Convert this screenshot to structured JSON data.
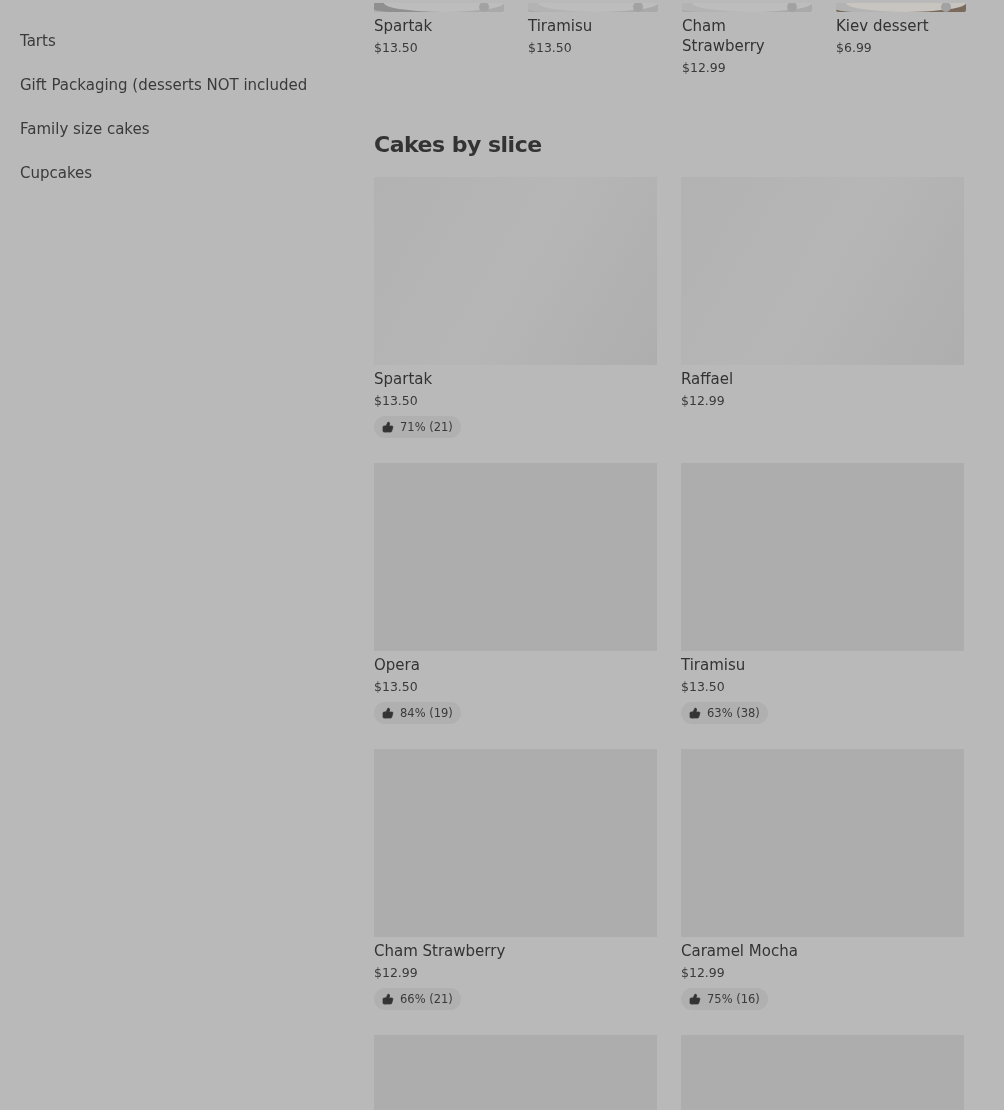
{
  "sidebar": {
    "items": [
      {
        "label": "Tarts"
      },
      {
        "label": "Gift Packaging (desserts NOT included"
      },
      {
        "label": "Family size cakes"
      },
      {
        "label": "Cupcakes"
      }
    ]
  },
  "top_row": [
    {
      "name": "Spartak",
      "price": "$13.50"
    },
    {
      "name": "Tiramisu",
      "price": "$13.50"
    },
    {
      "name": "Cham Strawberry",
      "price": "$12.99"
    },
    {
      "name": "Kiev dessert",
      "price": "$6.99"
    }
  ],
  "section": {
    "title": "Cakes by slice",
    "products": [
      {
        "kind": "product",
        "name": "Spartak",
        "price": "$13.50",
        "rating": "71% (21)"
      },
      {
        "kind": "product",
        "name": "Raffael",
        "price": "$12.99"
      },
      {
        "kind": "product",
        "name": "Opera",
        "price": "$13.50",
        "rating": "84% (19)"
      },
      {
        "kind": "product",
        "name": "Tiramisu",
        "price": "$13.50",
        "rating": "63% (38)"
      },
      {
        "kind": "product",
        "name": "Cham  Strawberry",
        "price": "$12.99",
        "rating": "66% (21)"
      },
      {
        "kind": "product",
        "name": "Caramel Mocha",
        "price": "$12.99",
        "rating": "75% (16)"
      },
      {
        "kind": "image_only"
      },
      {
        "kind": "image_only"
      }
    ]
  }
}
